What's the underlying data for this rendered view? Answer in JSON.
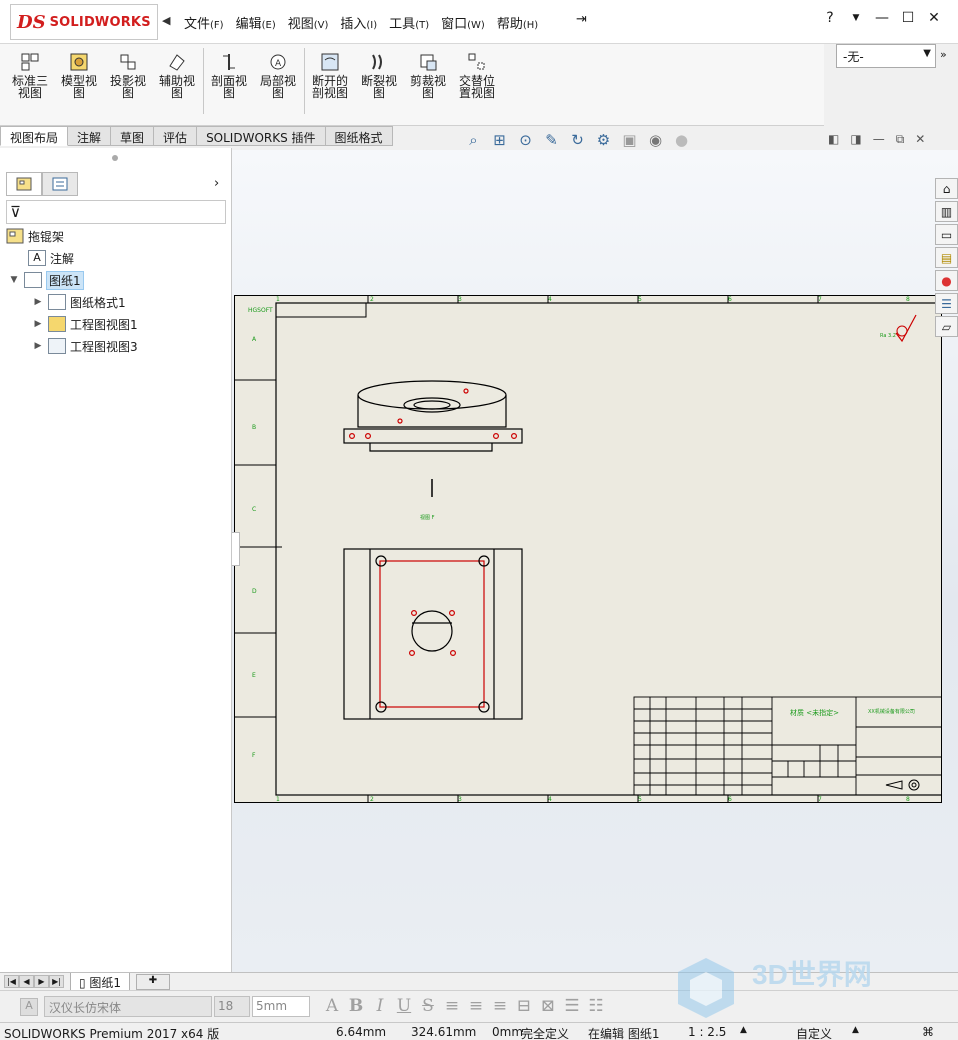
{
  "app": {
    "brand_mark": "DS",
    "brand": "SOLIDWORKS"
  },
  "menu": [
    {
      "label": "文件",
      "accel": "(F)"
    },
    {
      "label": "编辑",
      "accel": "(E)"
    },
    {
      "label": "视图",
      "accel": "(V)"
    },
    {
      "label": "插入",
      "accel": "(I)"
    },
    {
      "label": "工具",
      "accel": "(T)"
    },
    {
      "label": "窗口",
      "accel": "(W)"
    },
    {
      "label": "帮助",
      "accel": "(H)"
    }
  ],
  "window_controls": {
    "help": "?",
    "minimize": "—",
    "maximize": "☐",
    "close": "✕"
  },
  "command_manager": {
    "items": [
      {
        "label": "标准三\n视图",
        "icon": "standard-3-view-icon"
      },
      {
        "label": "模型视\n图",
        "icon": "model-view-icon"
      },
      {
        "label": "投影视\n图",
        "icon": "projected-view-icon"
      },
      {
        "label": "辅助视\n图",
        "icon": "auxiliary-view-icon"
      },
      {
        "label": "剖面视\n图",
        "icon": "section-view-icon"
      },
      {
        "label": "局部视\n图",
        "icon": "detail-view-icon"
      },
      {
        "label": "断开的\n剖视图",
        "icon": "broken-out-section-icon"
      },
      {
        "label": "断裂视\n图",
        "icon": "break-view-icon"
      },
      {
        "label": "剪裁视\n图",
        "icon": "crop-view-icon"
      },
      {
        "label": "交替位\n置视图",
        "icon": "alternate-position-icon"
      }
    ],
    "config_select": "-无-"
  },
  "tabs": [
    {
      "label": "视图布局",
      "active": true
    },
    {
      "label": "注解",
      "active": false
    },
    {
      "label": "草图",
      "active": false
    },
    {
      "label": "评估",
      "active": false
    },
    {
      "label": "SOLIDWORKS 插件",
      "active": false
    },
    {
      "label": "图纸格式",
      "active": false
    }
  ],
  "headsup_icons": [
    "zoom-to-fit-icon",
    "zoom-area-icon",
    "zoom-selection-icon",
    "pan-icon",
    "rotate-icon",
    "view-settings-icon",
    "display-style-icon",
    "hide-show-icon",
    "appearance-icon"
  ],
  "feature_tree": {
    "root": "拖锟架",
    "items": [
      {
        "label": "注解",
        "icon": "annotations-icon",
        "level": 1,
        "expander": ""
      },
      {
        "label": "图纸1",
        "icon": "sheet-icon",
        "level": 0,
        "expander": "▼",
        "selected": true
      },
      {
        "label": "图纸格式1",
        "icon": "sheet-format-icon",
        "level": 2,
        "expander": "▶"
      },
      {
        "label": "工程图视图1",
        "icon": "drawing-view-icon",
        "level": 2,
        "expander": "▶"
      },
      {
        "label": "工程图视图3",
        "icon": "drawing-view-3-icon",
        "level": 2,
        "expander": "▶"
      }
    ]
  },
  "drawing": {
    "zone_columns": [
      "1",
      "2",
      "3",
      "4",
      "5",
      "6",
      "7",
      "8"
    ],
    "zone_rows": [
      "A",
      "B",
      "C",
      "D",
      "E",
      "F"
    ],
    "corner_text": "HGSOFT",
    "view_label": "视图 F",
    "title_block_name": "材质 <未指定>",
    "title_block_company": "XX机械设备有限公司",
    "roughness_text": "Ra 3.2"
  },
  "sheet_tabs": {
    "active": "图纸1"
  },
  "format_bar": {
    "font": "汉仪长仿宋体",
    "size": "18",
    "height": "5mm"
  },
  "watermark": {
    "text": "3D世界网"
  },
  "status": {
    "product": "SOLIDWORKS Premium 2017 x64 版",
    "x": "6.64mm",
    "y": "324.61mm",
    "z": "0mm",
    "definition": "完全定义",
    "editing": "在编辑 图纸1",
    "scale": "1 : 2.5",
    "units": "自定义"
  }
}
